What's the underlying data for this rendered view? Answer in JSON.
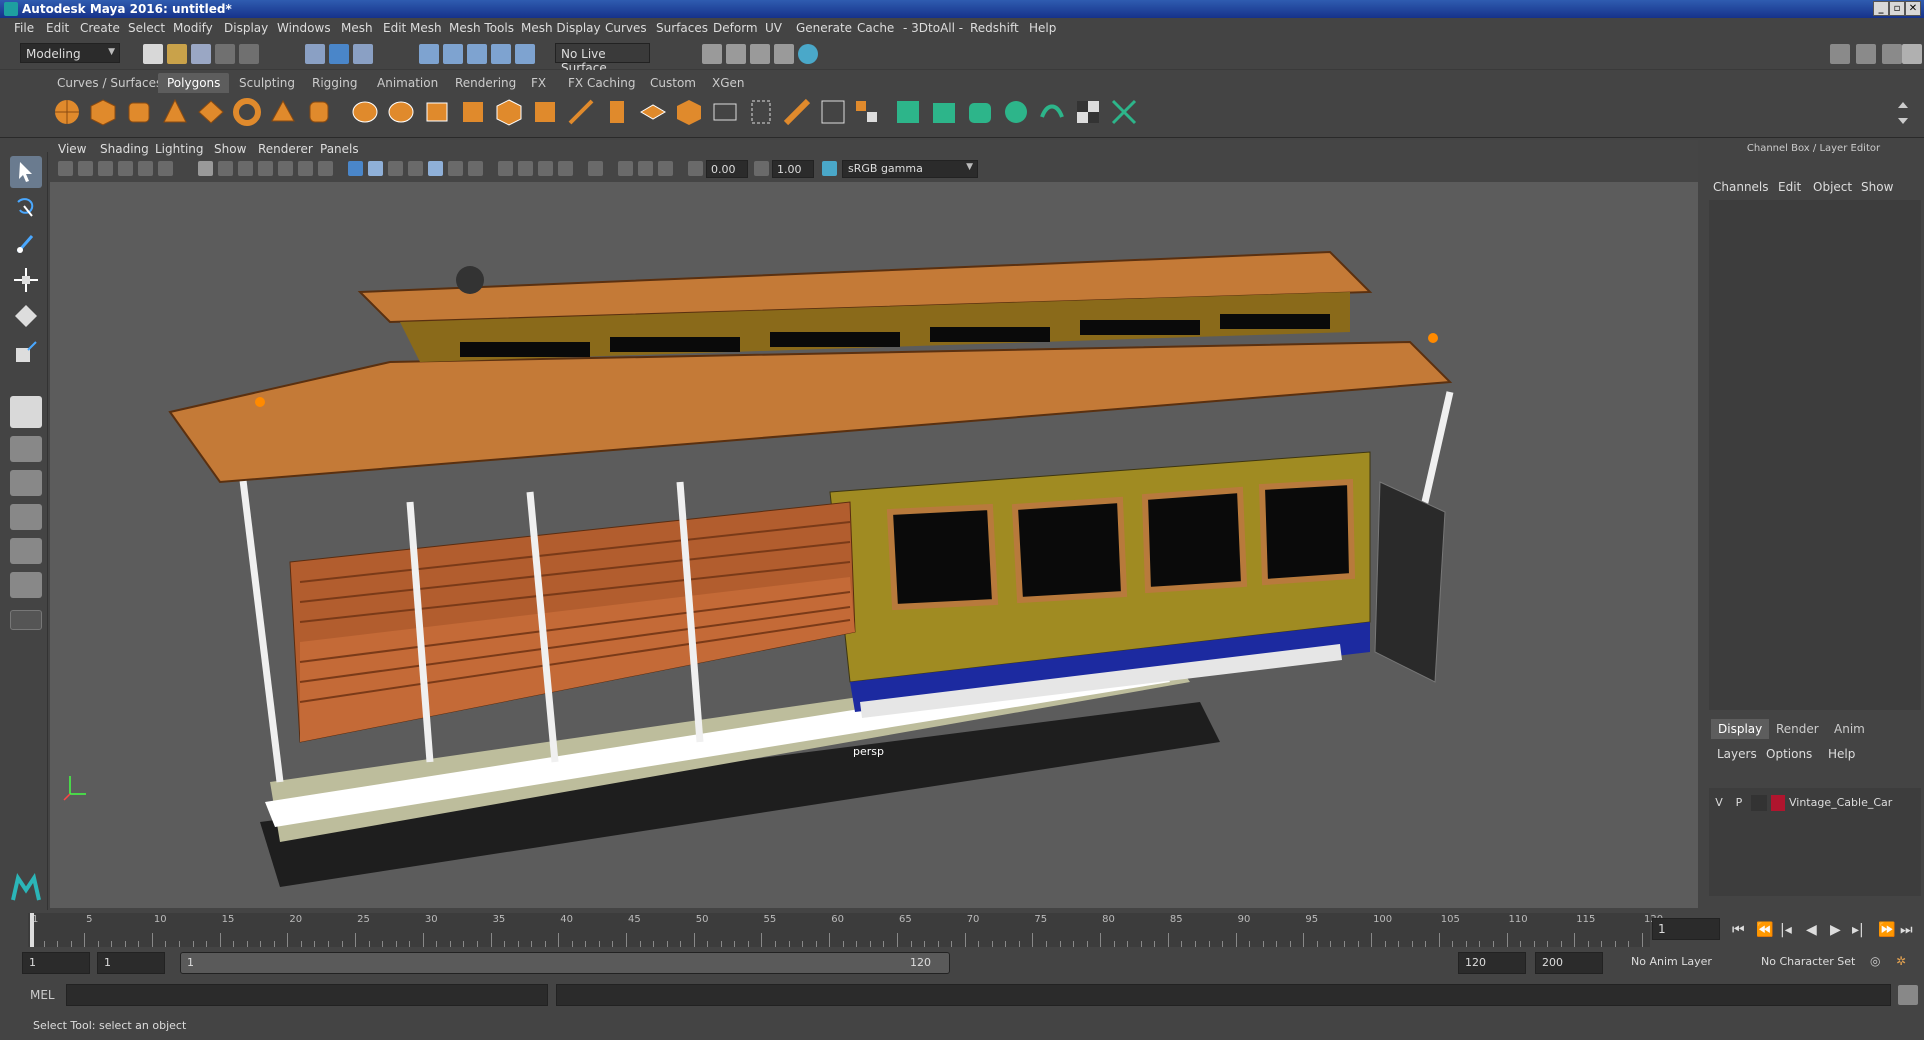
{
  "window": {
    "title": "Autodesk Maya 2016: untitled*"
  },
  "menubar": [
    "File",
    "Edit",
    "Create",
    "Select",
    "Modify",
    "Display",
    "Windows",
    "Mesh",
    "Edit Mesh",
    "Mesh Tools",
    "Mesh Display",
    "Curves",
    "Surfaces",
    "Deform",
    "UV",
    "Generate",
    "Cache",
    "- 3DtoAll -",
    "Redshift",
    "Help"
  ],
  "statusline": {
    "mode": "Modeling",
    "live_surface": "No Live Surface"
  },
  "shelf": {
    "tabs": [
      "Curves / Surfaces",
      "Polygons",
      "Sculpting",
      "Rigging",
      "Animation",
      "Rendering",
      "FX",
      "FX Caching",
      "Custom",
      "XGen"
    ],
    "active_tab": "Polygons"
  },
  "viewport": {
    "menus": [
      "View",
      "Shading",
      "Lighting",
      "Show",
      "Renderer",
      "Panels"
    ],
    "near_value": "0.00",
    "far_value": "1.00",
    "color_space": "sRGB gamma",
    "camera": "persp"
  },
  "channelbox": {
    "title": "Channel Box / Layer Editor",
    "menus": [
      "Channels",
      "Edit",
      "Object",
      "Show"
    ],
    "tabs": [
      "Display",
      "Render",
      "Anim"
    ],
    "active_tab": "Display",
    "layer_menus": [
      "Layers",
      "Options",
      "Help"
    ],
    "layer": {
      "v": "V",
      "p": "P",
      "name": "Vintage_Cable_Car",
      "color": "#b0152e"
    }
  },
  "timeslider": {
    "ticks": [
      "1",
      "5",
      "10",
      "15",
      "20",
      "25",
      "30",
      "35",
      "40",
      "45",
      "50",
      "55",
      "60",
      "65",
      "70",
      "75",
      "80",
      "85",
      "90",
      "95",
      "100",
      "105",
      "110",
      "115",
      "120"
    ],
    "current_frame": "1"
  },
  "rangeslider": {
    "start_a": "1",
    "start_b": "1",
    "range_start": "1",
    "range_end": "120",
    "end_a": "120",
    "end_b": "200",
    "anim_layer": "No Anim Layer",
    "character_set": "No Character Set"
  },
  "cmdline": {
    "label": "MEL"
  },
  "helpline": {
    "text": "Select Tool: select an object"
  }
}
